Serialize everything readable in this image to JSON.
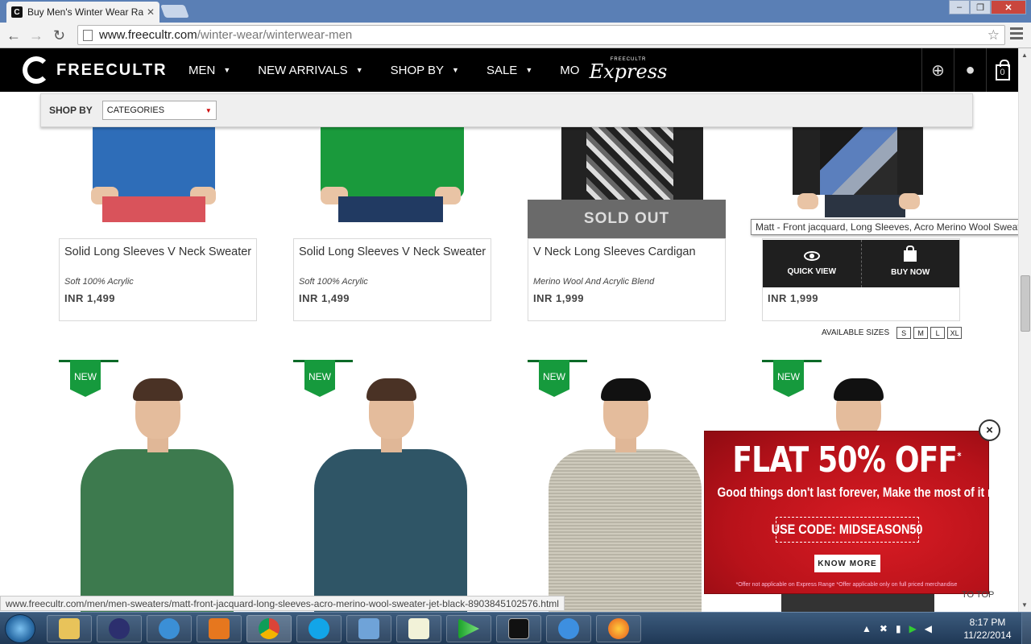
{
  "browser": {
    "tab_title": "Buy Men's Winter Wear Ra",
    "tab_favicon": "C",
    "url_host": "www.freecultr.com",
    "url_path": "/winter-wear/winterwear-men",
    "status_url": "www.freecultr.com/men/men-sweaters/matt-front-jacquard-long-sleeves-acro-merino-wool-sweater-jet-black-8903845102576.html"
  },
  "header": {
    "logo_text": "FREECULTR",
    "nav": [
      "MEN",
      "NEW ARRIVALS",
      "SHOP BY",
      "SALE",
      "MORE"
    ],
    "express_small": "FREECULTR",
    "express_big": "Express",
    "cart_count": "0"
  },
  "shopby": {
    "label": "SHOP BY",
    "selected": "CATEGORIES"
  },
  "products_top": [
    {
      "name": "Solid Long Sleeves V Neck Sweater",
      "desc": "Soft 100% Acrylic",
      "price": "INR  1,499"
    },
    {
      "name": "Solid Long Sleeves V Neck Sweater",
      "desc": "Soft 100% Acrylic",
      "price": "INR  1,499"
    },
    {
      "name": "V Neck Long Sleeves Cardigan",
      "desc": "Merino Wool And Acrylic Blend",
      "price": "INR  1,999",
      "badge": "SOLD OUT"
    },
    {
      "name": "Matt - Front jacquard, Long Sleeves, Acro Merino Wool Sweater",
      "price": "INR  1,999",
      "quick_view": "QUICK VIEW",
      "buy_now": "BUY NOW"
    }
  ],
  "sizes": {
    "label": "AVAILABLE SIZES",
    "options": [
      "S",
      "M",
      "L",
      "XL"
    ]
  },
  "new_badge": "NEW",
  "promo": {
    "headline": "FLAT 50% OFF",
    "sup": "*",
    "subline": "Good things don't last forever, Make the most of it now!",
    "code": "USE CODE: MIDSEASON50",
    "button": "KNOW MORE",
    "fine_print": "*Offer not applicable on Express Range *Offer applicable only on full priced merchandise",
    "close": "×"
  },
  "to_top": "TO TOP",
  "taskbar": {
    "time": "8:17 PM",
    "date": "11/22/2014"
  },
  "colors": {
    "brand_black": "#000000",
    "promo_red": "#c8141c",
    "new_green": "#169a3d"
  }
}
